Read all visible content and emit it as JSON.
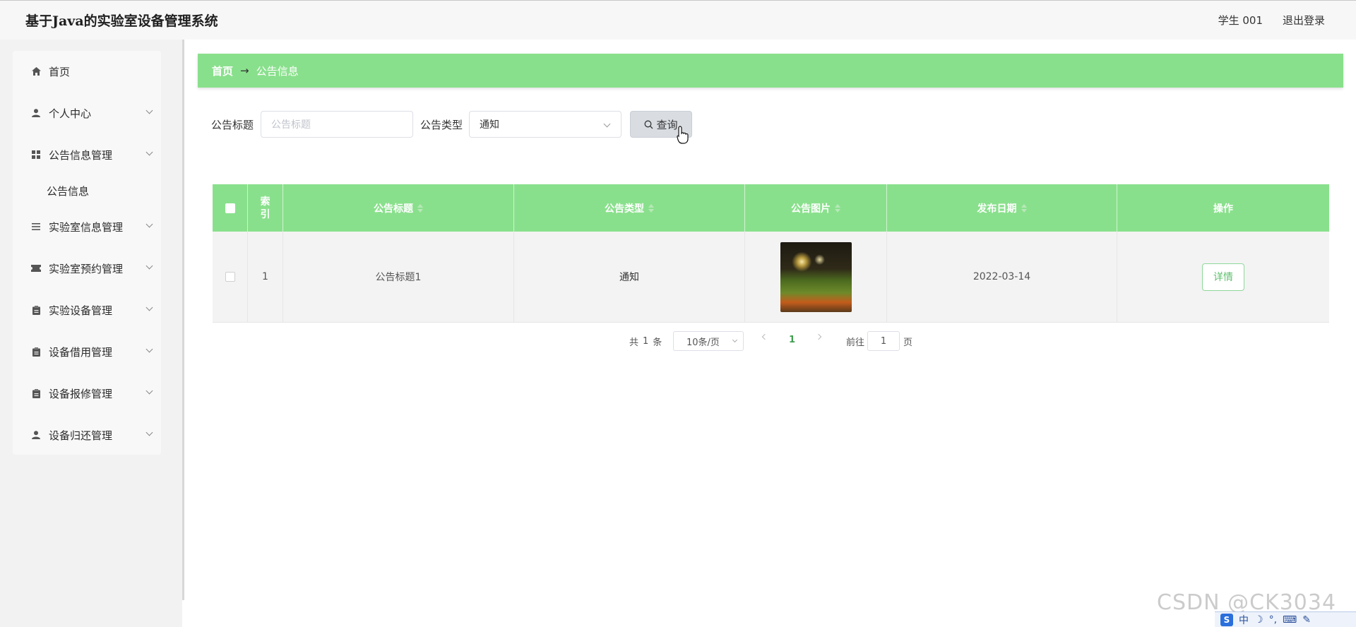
{
  "header": {
    "app_title": "基于Java的实验室设备管理系统",
    "user_label": "学生  001",
    "logout_label": "退出登录"
  },
  "sidebar": {
    "items": [
      {
        "label": "首页",
        "icon": "home-icon"
      },
      {
        "label": "个人中心",
        "icon": "user-icon"
      },
      {
        "label": "公告信息管理",
        "icon": "grid-icon"
      },
      {
        "label": "实验室信息管理",
        "icon": "list-icon"
      },
      {
        "label": "实验室预约管理",
        "icon": "ticket-icon"
      },
      {
        "label": "实验设备管理",
        "icon": "clipboard-icon"
      },
      {
        "label": "设备借用管理",
        "icon": "clipboard-icon"
      },
      {
        "label": "设备报修管理",
        "icon": "clipboard-icon"
      },
      {
        "label": "设备归还管理",
        "icon": "user-icon"
      }
    ],
    "subitem": {
      "label": "公告信息"
    }
  },
  "breadcrumb": {
    "home": "首页",
    "separator": "→",
    "current": "公告信息"
  },
  "search": {
    "title_label": "公告标题",
    "title_placeholder": "公告标题",
    "type_label": "公告类型",
    "type_value": "通知",
    "button_label": "查询"
  },
  "table": {
    "headers": {
      "index": "索引",
      "title": "公告标题",
      "type": "公告类型",
      "image": "公告图片",
      "date": "发布日期",
      "action": "操作"
    },
    "rows": [
      {
        "index": "1",
        "title": "公告标题1",
        "type": "通知",
        "date": "2022-03-14",
        "action": "详情"
      }
    ]
  },
  "pagination": {
    "total_prefix": "共",
    "total": "1",
    "total_suffix": "条",
    "page_size": "10条/页",
    "current_page": "1",
    "jump_prefix": "前往",
    "jump_value": "1",
    "jump_suffix": "页"
  },
  "watermark": "CSDN @CK3034",
  "ime": {
    "mode": "中"
  },
  "colors": {
    "accent_green": "#89e08c",
    "link_green": "#409e4f"
  }
}
